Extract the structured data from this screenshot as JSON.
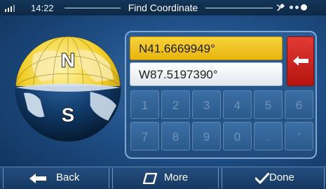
{
  "status_bar": {
    "time": "14:22",
    "title": "Find Coordinate",
    "gps_icon": "satellite-gps-icon"
  },
  "globe": {
    "north_label": "N",
    "south_label": "S",
    "north_color": "#f2cf2a",
    "south_color": "#0f2e55"
  },
  "coordinates": {
    "latitude": "N41.6669949°",
    "longitude": "W87.5197390°"
  },
  "keypad": {
    "row1": [
      "1",
      "2",
      "3",
      "4",
      "5",
      "6"
    ],
    "row2": [
      "7",
      "8",
      "9",
      "0",
      ".",
      "'"
    ]
  },
  "bottom_bar": {
    "back_label": "Back",
    "more_label": "More",
    "done_label": "Done"
  },
  "colors": {
    "accent_yellow": "#f2cf2a",
    "backspace_red": "#d6231e",
    "background_blue": "#1f4f86"
  }
}
